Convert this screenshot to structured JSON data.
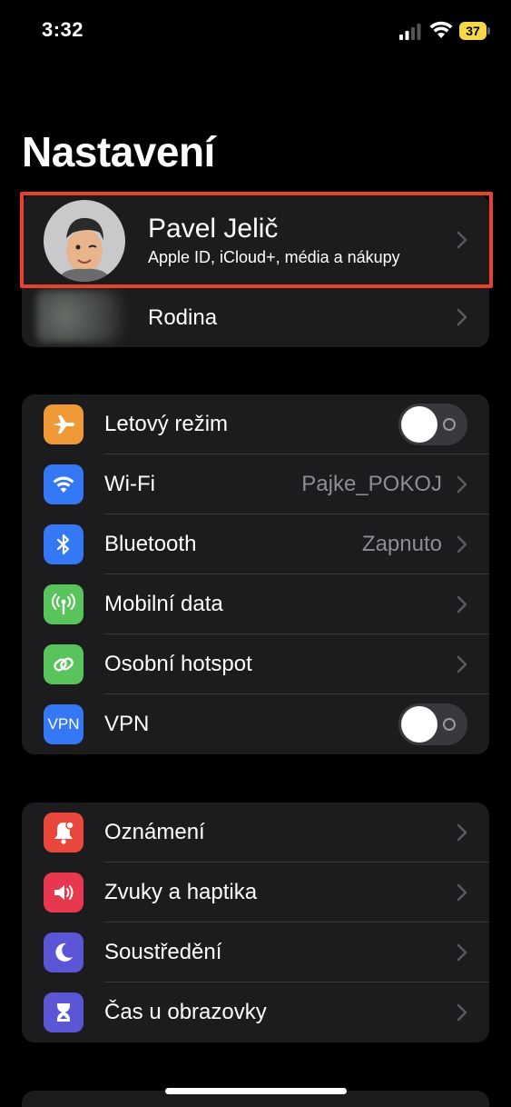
{
  "status_bar": {
    "time": "3:32",
    "battery": "37"
  },
  "header": {
    "title": "Nastavení"
  },
  "profile": {
    "name": "Pavel Jelič",
    "subtitle": "Apple ID, iCloud+, média a nákupy",
    "family_label": "Rodina"
  },
  "connectivity": [
    {
      "label": "Letový režim",
      "icon": "airplane-icon",
      "color": "#f09a37",
      "control": "toggle",
      "on": false
    },
    {
      "label": "Wi-Fi",
      "icon": "wifi-icon",
      "color": "#3478f6",
      "value": "Pajke_POKOJ",
      "control": "chevron"
    },
    {
      "label": "Bluetooth",
      "icon": "bluetooth-icon",
      "color": "#3478f6",
      "value": "Zapnuto",
      "control": "chevron"
    },
    {
      "label": "Mobilní data",
      "icon": "antenna-icon",
      "color": "#58c45b",
      "control": "chevron"
    },
    {
      "label": "Osobní hotspot",
      "icon": "hotspot-icon",
      "color": "#58c45b",
      "control": "chevron"
    },
    {
      "label": "VPN",
      "icon_text": "VPN",
      "icon": "vpn-icon",
      "color": "#3478f6",
      "control": "toggle",
      "on": false
    }
  ],
  "notifications_group": [
    {
      "label": "Oznámení",
      "icon": "bell-icon",
      "color": "#e9473b"
    },
    {
      "label": "Zvuky a haptika",
      "icon": "speaker-icon",
      "color": "#e8384f"
    },
    {
      "label": "Soustředění",
      "icon": "moon-icon",
      "color": "#5b56d6"
    },
    {
      "label": "Čas u obrazovky",
      "icon": "hourglass-icon",
      "color": "#5b56d6"
    }
  ],
  "colors": {
    "background": "#000000",
    "cell": "#1c1c1e",
    "highlight": "#e8432a",
    "secondary_text": "#8d8d93"
  }
}
